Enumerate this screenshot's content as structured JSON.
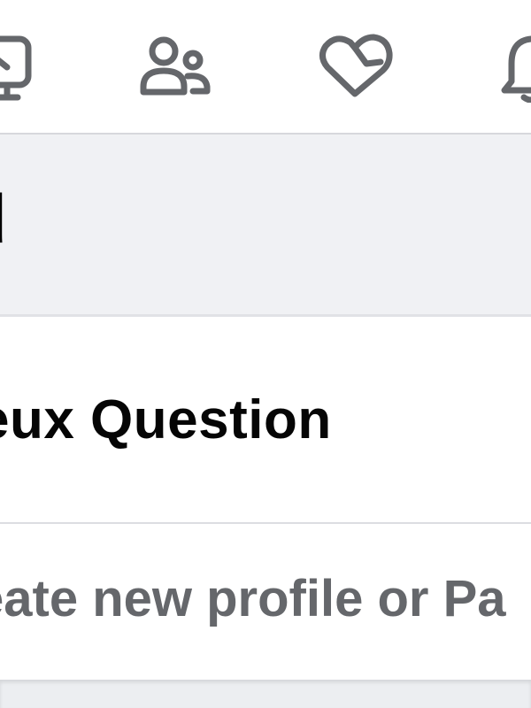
{
  "nav": {
    "icons": [
      {
        "name": "monitor-icon"
      },
      {
        "name": "friends-icon"
      },
      {
        "name": "dating-heart-icon"
      },
      {
        "name": "bell-icon"
      }
    ],
    "icon_color": "#65676b"
  },
  "band": {
    "partial_text": "d"
  },
  "profile": {
    "name": "eux Question"
  },
  "create": {
    "label": "eate new profile or Pa"
  }
}
